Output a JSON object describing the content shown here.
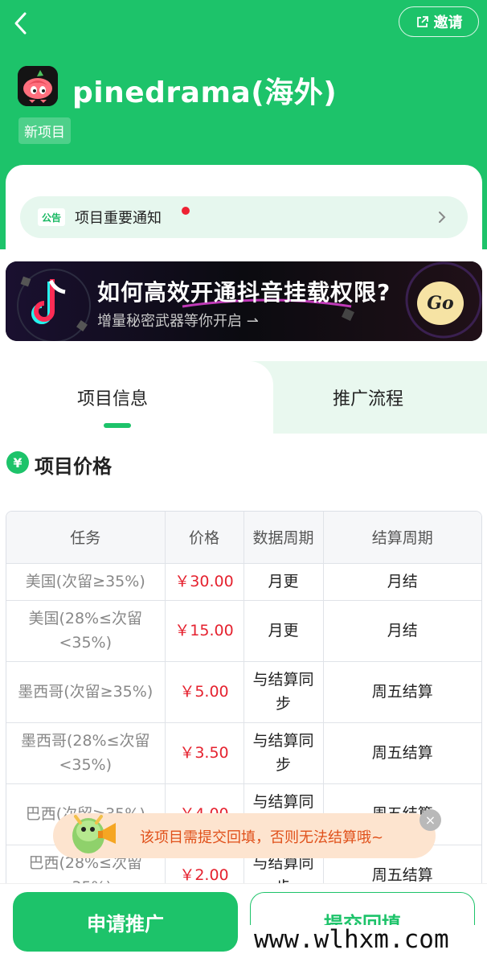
{
  "header": {
    "back_icon": "chevron-left-icon",
    "invite_label": "邀请",
    "invite_icon": "external-link-icon",
    "app_name": "pinedrama(海外)",
    "tag": "新项目",
    "accent_color": "#1dc36a"
  },
  "notice": {
    "badge": "公告",
    "text": "项目重要通知"
  },
  "banner": {
    "title": "如何高效开通抖音挂载权限?",
    "subtitle": "增量秘密武器等你开启 ⇀",
    "go_label": "Go"
  },
  "tabs": [
    {
      "label": "项目信息",
      "active": true
    },
    {
      "label": "推广流程",
      "active": false
    }
  ],
  "section": {
    "icon": "¥",
    "title": "项目价格"
  },
  "table": {
    "headers": [
      "任务",
      "价格",
      "数据周期",
      "结算周期"
    ],
    "rows": [
      {
        "task": "美国(次留≥35%)",
        "price": "￥30.00",
        "data_cycle": "月更",
        "settle_cycle": "月结"
      },
      {
        "task": "美国(28%≤次留<35%)",
        "price": "￥15.00",
        "data_cycle": "月更",
        "settle_cycle": "月结"
      },
      {
        "task": "墨西哥(次留≥35%)",
        "price": "￥5.00",
        "data_cycle": "与结算同步",
        "settle_cycle": "周五结算"
      },
      {
        "task": "墨西哥(28%≤次留<35%)",
        "price": "￥3.50",
        "data_cycle": "与结算同步",
        "settle_cycle": "周五结算"
      },
      {
        "task": "巴西(次留≥35%)",
        "price": "￥4.00",
        "data_cycle": "与结算同步",
        "settle_cycle": "周五结算"
      },
      {
        "task": "巴西(28%≤次留<35%)",
        "price": "￥2.00",
        "data_cycle": "与结算同步",
        "settle_cycle": "周五结算"
      }
    ]
  },
  "toast": {
    "text": "该项目需提交回填，否则无法结算哦~",
    "close": "×"
  },
  "bottom": {
    "apply_label": "申请推广",
    "submit_label": "提交回填"
  },
  "watermark": "www.wlhxm.com"
}
